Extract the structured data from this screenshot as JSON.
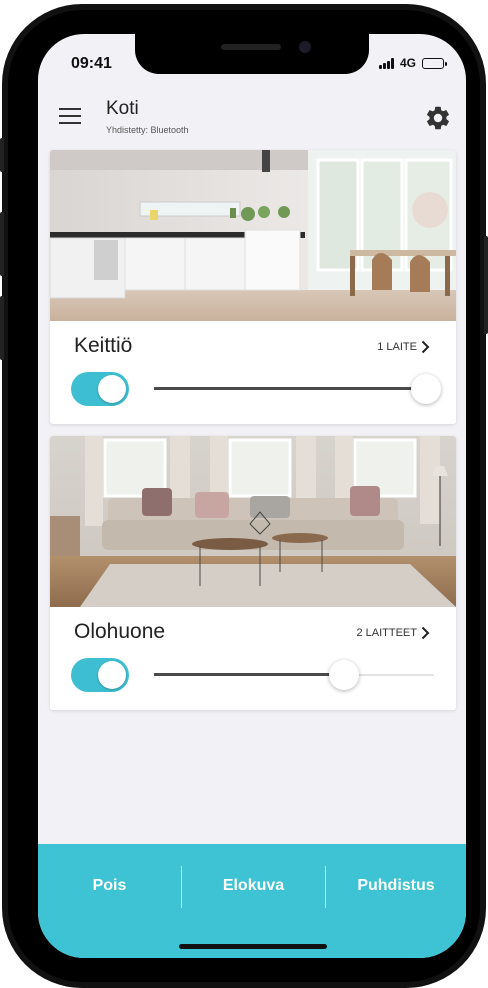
{
  "status_bar": {
    "time": "09:41",
    "network": "4G"
  },
  "header": {
    "title": "Koti",
    "subtitle": "Yhdistetty: Bluetooth"
  },
  "rooms": [
    {
      "name": "Keittiö",
      "device_count": "1 LAITE",
      "toggle_on": true,
      "level": 0.97
    },
    {
      "name": "Olohuone",
      "device_count": "2 LAITTEET",
      "toggle_on": true,
      "level": 0.68
    }
  ],
  "bottom_actions": [
    {
      "label": "Pois"
    },
    {
      "label": "Elokuva"
    },
    {
      "label": "Puhdistus"
    }
  ],
  "colors": {
    "accent": "#3ec3d4",
    "toggle": "#3dbfd1",
    "background": "#f2f1f5"
  }
}
